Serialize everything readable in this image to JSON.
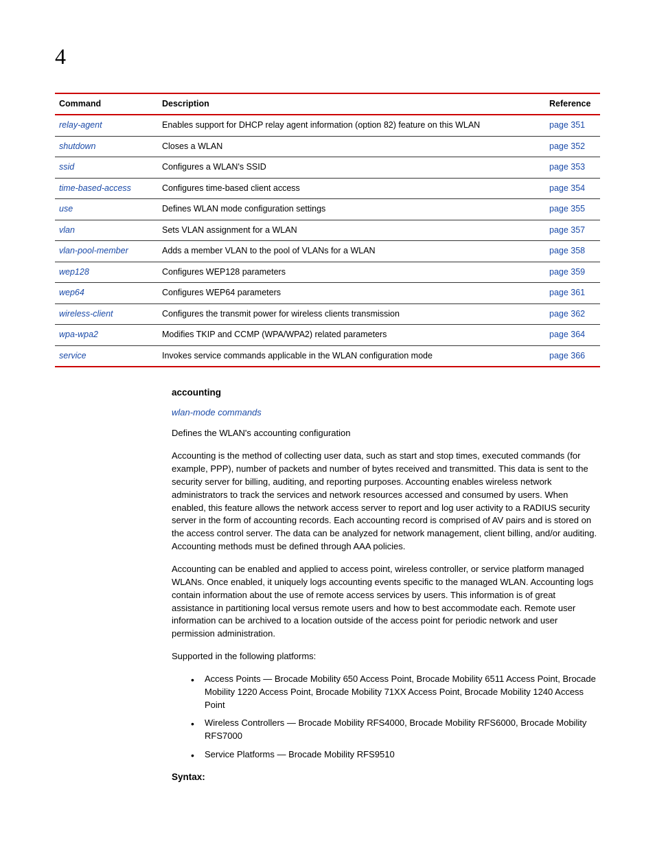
{
  "chapterNumber": "4",
  "table": {
    "headers": {
      "command": "Command",
      "description": "Description",
      "reference": "Reference"
    },
    "rows": [
      {
        "command": "relay-agent",
        "description": "Enables support for DHCP relay agent information (option 82) feature on this WLAN",
        "reference": "page 351"
      },
      {
        "command": "shutdown",
        "description": "Closes a WLAN",
        "reference": "page 352"
      },
      {
        "command": "ssid",
        "description": "Configures a WLAN's SSID",
        "reference": "page 353"
      },
      {
        "command": "time-based-access",
        "description": "Configures time-based client access",
        "reference": "page 354"
      },
      {
        "command": "use",
        "description": "Defines WLAN mode configuration settings",
        "reference": "page 355"
      },
      {
        "command": "vlan",
        "description": "Sets VLAN assignment for a WLAN",
        "reference": "page 357"
      },
      {
        "command": "vlan-pool-member",
        "description": "Adds a member VLAN to the pool of VLANs for a WLAN",
        "reference": "page 358"
      },
      {
        "command": "wep128",
        "description": "Configures WEP128 parameters",
        "reference": "page 359"
      },
      {
        "command": "wep64",
        "description": "Configures WEP64 parameters",
        "reference": "page 361"
      },
      {
        "command": "wireless-client",
        "description": "Configures the transmit power for wireless clients transmission",
        "reference": "page 362"
      },
      {
        "command": "wpa-wpa2",
        "description": "Modifies TKIP and CCMP (WPA/WPA2) related parameters",
        "reference": "page 364"
      },
      {
        "command": "service",
        "description": "Invokes service commands applicable in the WLAN configuration mode",
        "reference": "page 366"
      }
    ]
  },
  "section": {
    "title": "accounting",
    "subLink": "wlan-mode commands",
    "intro": "Defines the WLAN's accounting configuration",
    "para1": "Accounting is the method of collecting user data, such as start and stop times, executed commands (for example, PPP), number of packets and number of bytes received and transmitted. This data is sent to the security server for billing, auditing, and reporting purposes. Accounting enables wireless network administrators to track the services and network resources accessed and consumed by users. When enabled, this feature allows the network access server to report and log user activity to a RADIUS security server in the form of accounting records. Each accounting record is comprised of AV pairs and is stored on the access control server. The data can be analyzed for network management, client billing, and/or auditing. Accounting methods must be defined through AAA policies.",
    "para2": "Accounting can be enabled and applied to access point, wireless controller, or service platform managed WLANs. Once enabled, it uniquely logs accounting events specific to the managed WLAN. Accounting logs contain information about the use of remote access services by users. This information is of great assistance in partitioning local versus remote users and how to best accommodate each. Remote user information can be archived to a location outside of the access point for periodic network and user permission administration.",
    "supportedLabel": "Supported in the following platforms:",
    "platforms": [
      "Access Points — Brocade Mobility 650 Access Point, Brocade Mobility 6511 Access Point, Brocade Mobility 1220 Access Point, Brocade Mobility 71XX Access Point, Brocade Mobility 1240 Access Point",
      "Wireless Controllers — Brocade Mobility RFS4000, Brocade Mobility RFS6000, Brocade Mobility RFS7000",
      "Service Platforms — Brocade Mobility RFS9510"
    ],
    "syntaxLabel": "Syntax:"
  }
}
